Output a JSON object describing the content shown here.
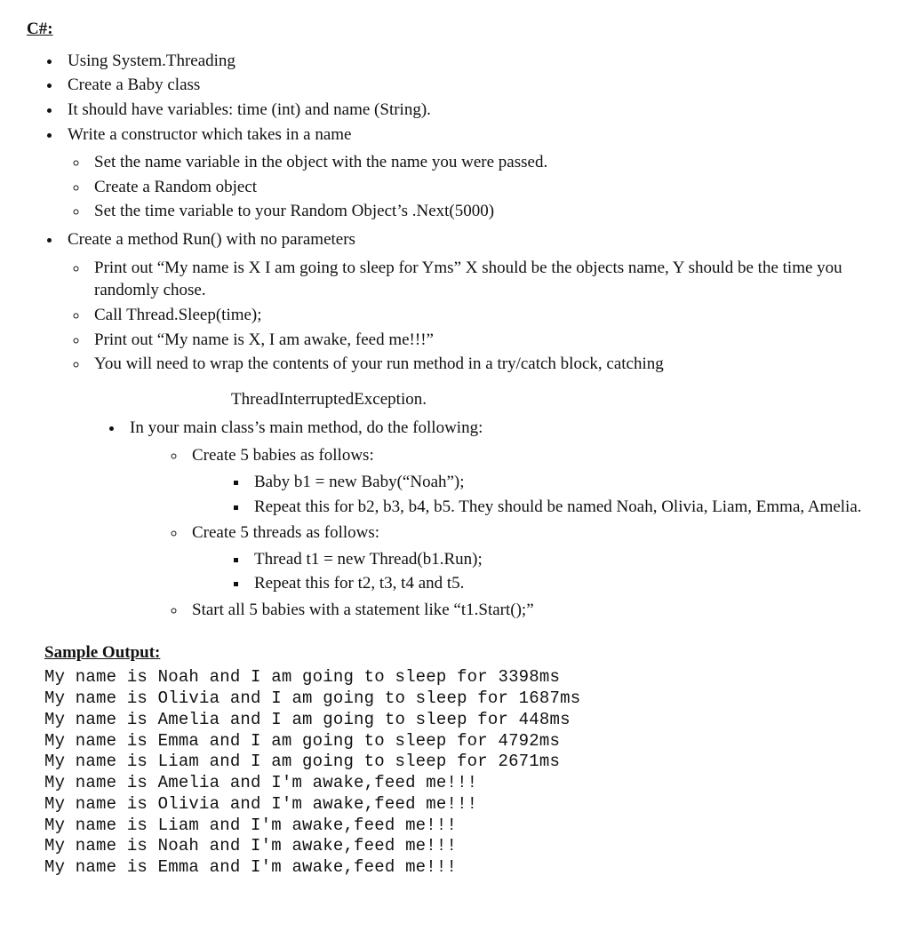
{
  "heading": "C#:",
  "list1": {
    "items": [
      "Using System.Threading",
      "Create a Baby class",
      "It should have variables:  time (int) and name (String).",
      "Write a constructor which takes in a name"
    ],
    "sub_constructor": [
      "Set the name variable in the object with the name you were passed.",
      "Create a Random object",
      "Set the time variable to your Random Object’s .Next(5000)"
    ],
    "run_header": "Create a method Run() with no parameters",
    "sub_run": [
      "Print out “My name is X I am going to sleep for Yms”   X should be the objects name, Y should be the time you randomly chose.",
      "Call Thread.Sleep(time);",
      "Print out “My name is X, I am awake, feed me!!!”",
      "You will need to wrap the contents of your run method in a try/catch block, catching"
    ]
  },
  "exception_text": "ThreadInterruptedException.",
  "list2": {
    "main_header": "In your main class’s main method, do the following:",
    "create_babies": "Create 5 babies as follows:",
    "babies_sub": [
      "Baby b1 = new Baby(“Noah”);",
      "Repeat this for b2, b3, b4, b5.  They should be named Noah, Olivia, Liam, Emma, Amelia."
    ],
    "create_threads": "Create 5 threads as follows:",
    "threads_sub": [
      "Thread t1 = new Thread(b1.Run);",
      "Repeat this for t2, t3, t4 and t5."
    ],
    "start_babies": "Start all 5 babies with a statement like “t1.Start();”"
  },
  "sample_heading": "Sample Output:",
  "sample_output": "My name is Noah and I am going to sleep for 3398ms\nMy name is Olivia and I am going to sleep for 1687ms\nMy name is Amelia and I am going to sleep for 448ms\nMy name is Emma and I am going to sleep for 4792ms\nMy name is Liam and I am going to sleep for 2671ms\nMy name is Amelia and I'm awake,feed me!!!\nMy name is Olivia and I'm awake,feed me!!!\nMy name is Liam and I'm awake,feed me!!!\nMy name is Noah and I'm awake,feed me!!!\nMy name is Emma and I'm awake,feed me!!!"
}
